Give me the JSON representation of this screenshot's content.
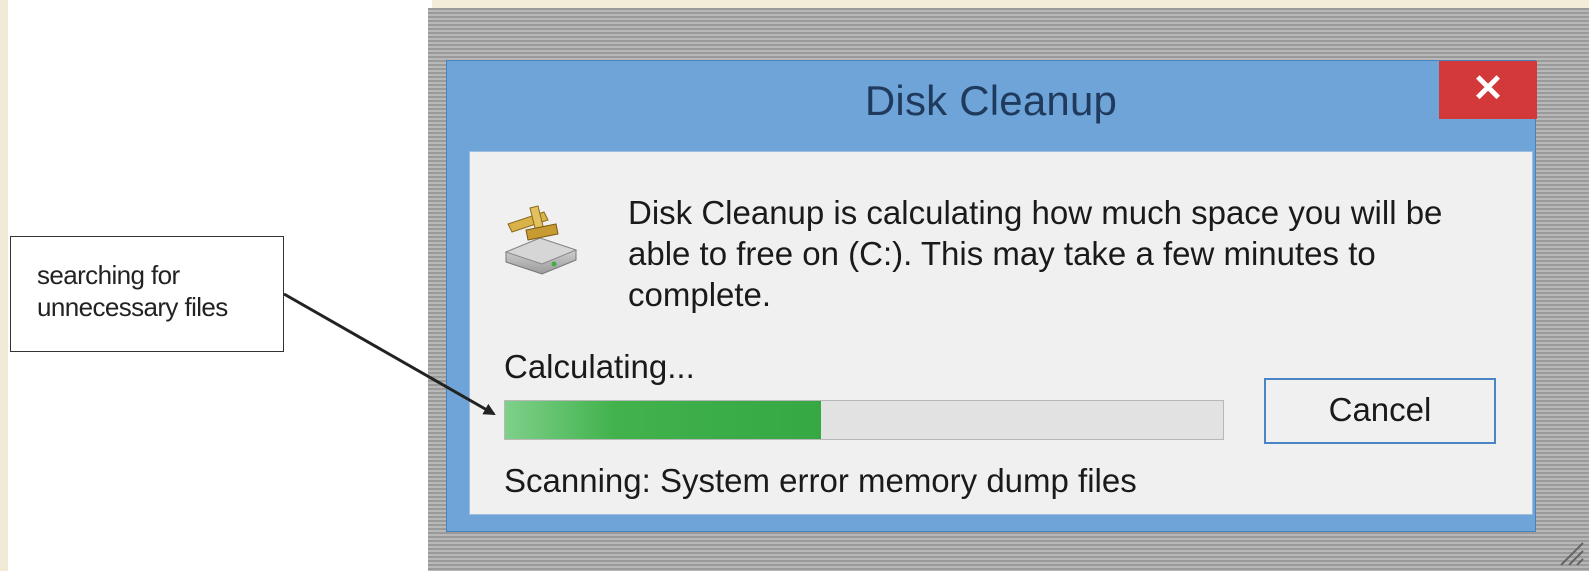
{
  "callout": {
    "line1": "searching for",
    "line2": "unnecessary files"
  },
  "dialog": {
    "title": "Disk Cleanup",
    "close_label": "✕",
    "message": "Disk Cleanup is calculating how much space you will be able to free on  (C:). This may take a few minutes to complete.",
    "status": "Calculating...",
    "progress_fraction": 0.44,
    "cancel_label": "Cancel",
    "scanning": "Scanning:  System error memory dump files",
    "icon": "disk-cleanup-icon"
  },
  "colors": {
    "title_bar": "#6ea4d8",
    "close_button": "#d3383a",
    "progress_fill": "#41b24c",
    "button_border": "#4a86c5"
  }
}
